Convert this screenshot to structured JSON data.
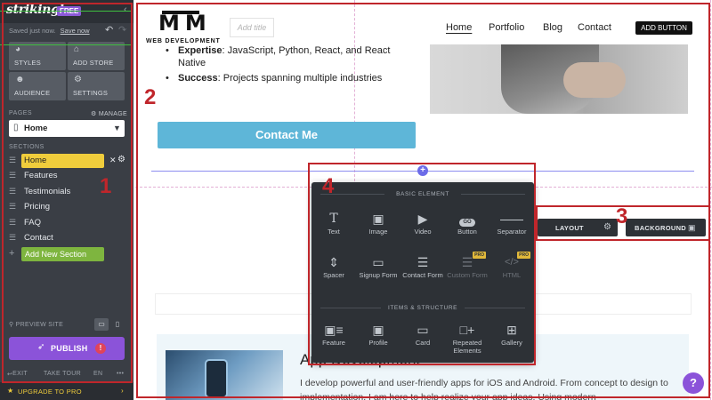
{
  "sidebar": {
    "logo": "strikingly",
    "badge": "FREE",
    "save_status": "Saved just now.",
    "save_link": "Save now",
    "tools": [
      {
        "label": "STYLES",
        "icon": "palette-icon"
      },
      {
        "label": "ADD STORE",
        "icon": "store-icon"
      },
      {
        "label": "AUDIENCE",
        "icon": "audience-icon"
      },
      {
        "label": "SETTINGS",
        "icon": "gear-icon"
      }
    ],
    "pages_label": "PAGES",
    "manage_label": "MANAGE",
    "current_page": "Home",
    "sections_label": "SECTIONS",
    "sections": [
      "Home",
      "Features",
      "Testimonials",
      "Pricing",
      "FAQ",
      "Contact"
    ],
    "add_section": "Add New Section",
    "preview_label": "PREVIEW SITE",
    "publish_label": "PUBLISH",
    "publish_warning": "!",
    "bottom_links": {
      "exit": "EXIT",
      "tour": "TAKE TOUR",
      "lang": "EN",
      "more": "•••"
    },
    "upgrade_label": "UPGRADE TO PRO"
  },
  "site": {
    "logo_mark": "MM",
    "logo_sub": "WEB DEVELOPMENT",
    "add_title_placeholder": "Add title",
    "nav": [
      "Home",
      "Portfolio",
      "Blog",
      "Contact"
    ],
    "nav_button": "ADD BUTTON",
    "bullets": [
      {
        "bold": "Expertise",
        "text": ": JavaScript, Python, React, and React Native"
      },
      {
        "bold": "Success",
        "text": ": Projects spanning multiple industries"
      }
    ],
    "contact_button": "Contact Me",
    "feature_title": "App Development",
    "feature_desc": "I develop powerful and user-friendly apps for iOS and Android. From concept to design to implementation, I am here to help realize your app ideas. Using modern"
  },
  "popup": {
    "basic_heading": "BASIC ELEMENT",
    "basic": [
      {
        "label": "Text",
        "icon": "text-icon",
        "glyph": "T",
        "pro": false,
        "disabled": false
      },
      {
        "label": "Image",
        "icon": "image-icon",
        "glyph": "▣",
        "pro": false,
        "disabled": false
      },
      {
        "label": "Video",
        "icon": "video-icon",
        "glyph": "▶",
        "pro": false,
        "disabled": false
      },
      {
        "label": "Button",
        "icon": "button-icon",
        "glyph": "GO",
        "pro": false,
        "disabled": false
      },
      {
        "label": "Separator",
        "icon": "separator-icon",
        "glyph": "—",
        "pro": false,
        "disabled": false
      },
      {
        "label": "Spacer",
        "icon": "spacer-icon",
        "glyph": "⇕",
        "pro": false,
        "disabled": false
      },
      {
        "label": "Signup Form",
        "icon": "signup-form-icon",
        "glyph": "▭",
        "pro": false,
        "disabled": false
      },
      {
        "label": "Contact Form",
        "icon": "contact-form-icon",
        "glyph": "☰",
        "pro": false,
        "disabled": false
      },
      {
        "label": "Custom Form",
        "icon": "custom-form-icon",
        "glyph": "☰",
        "pro": true,
        "disabled": true
      },
      {
        "label": "HTML",
        "icon": "html-icon",
        "glyph": "</>",
        "pro": true,
        "disabled": true
      }
    ],
    "structure_heading": "ITEMS & STRUCTURE",
    "structure": [
      {
        "label": "Feature",
        "icon": "feature-icon",
        "glyph": "▣≡"
      },
      {
        "label": "Profile",
        "icon": "profile-icon",
        "glyph": "▣"
      },
      {
        "label": "Card",
        "icon": "card-icon",
        "glyph": "▭"
      },
      {
        "label": "Repeated Elements",
        "icon": "repeated-elements-icon",
        "glyph": "□+"
      },
      {
        "label": "Gallery",
        "icon": "gallery-icon",
        "glyph": "⊞"
      }
    ]
  },
  "section_tools": {
    "layout": "LAYOUT",
    "background": "BACKGROUND"
  },
  "help": "?",
  "annotations": [
    "1",
    "2",
    "3",
    "4"
  ],
  "colors": {
    "sidebar_bg": "#3a3e45",
    "accent_purple": "#8b53d9",
    "section_active": "#f0cd3c",
    "add_section": "#7eb53f",
    "contact_button": "#5eb6d8",
    "annotation_red": "#c0262b"
  }
}
